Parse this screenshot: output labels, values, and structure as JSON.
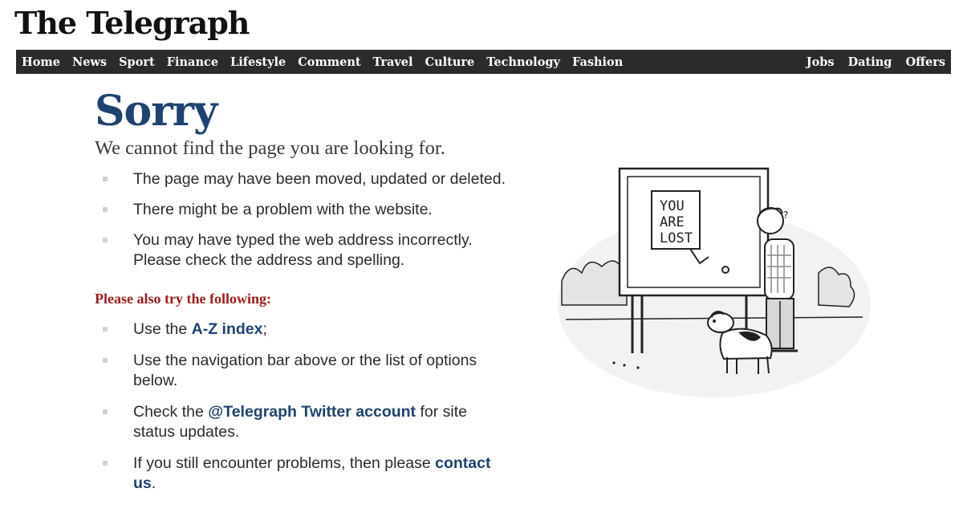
{
  "masthead": {
    "title": "The Telegraph"
  },
  "nav": {
    "left": [
      "Home",
      "News",
      "Sport",
      "Finance",
      "Lifestyle",
      "Comment",
      "Travel",
      "Culture",
      "Technology",
      "Fashion"
    ],
    "right": [
      "Jobs",
      "Dating",
      "Offers"
    ]
  },
  "error": {
    "heading": "Sorry",
    "subtitle": "We cannot find the page you are looking for.",
    "reasons": [
      "The page may have been moved, updated or deleted.",
      "There might be a problem with the website.",
      "You may have typed the web address incorrectly. Please check the address and spelling."
    ]
  },
  "suggestions": {
    "heading": "Please also try the following:",
    "item1": {
      "before": "Use the ",
      "link": "A-Z index",
      "after": ";"
    },
    "item2": {
      "text": "Use the navigation bar above or the list of options below."
    },
    "item3": {
      "before": "Check the ",
      "link": "@Telegraph Twitter account",
      "after": " for site status updates."
    },
    "item4": {
      "before": "If you still encounter problems, then please ",
      "link": "contact us",
      "after": "."
    }
  },
  "cartoon": {
    "sign_line1": "YOU",
    "sign_line2": "ARE",
    "sign_line3": "LOST"
  },
  "colors": {
    "heading": "#1f4370",
    "nav_bg": "#2b2b2b",
    "try_heading": "#9b1c1c",
    "link": "#1f4370"
  }
}
